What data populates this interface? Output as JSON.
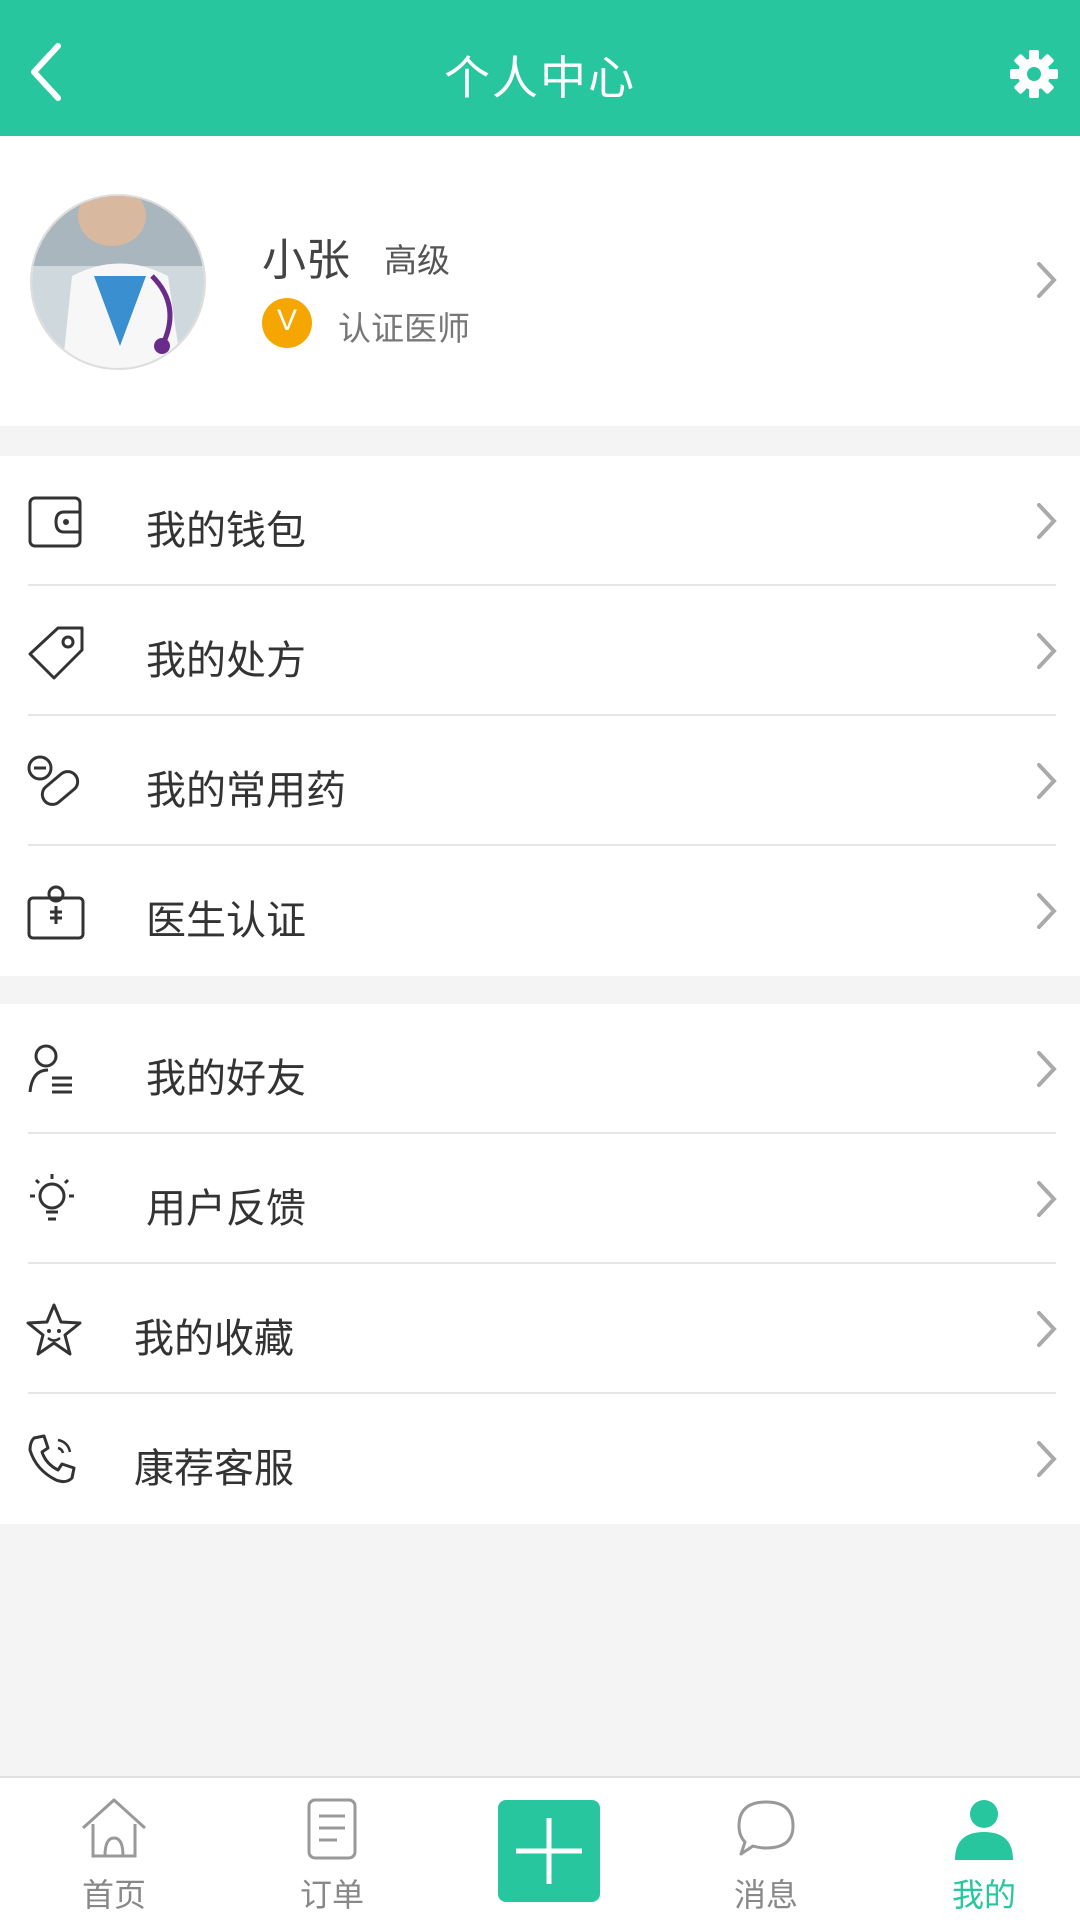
{
  "header": {
    "title": "个人中心"
  },
  "profile": {
    "name": "小张",
    "level": "高级",
    "badge_letter": "V",
    "certification": "认证医师"
  },
  "menu_group_1": [
    {
      "label": "我的钱包",
      "icon": "wallet-icon"
    },
    {
      "label": "我的处方",
      "icon": "tag-icon"
    },
    {
      "label": "我的常用药",
      "icon": "pills-icon"
    },
    {
      "label": "医生认证",
      "icon": "doctor-kit-icon"
    }
  ],
  "menu_group_2": [
    {
      "label": "我的好友",
      "icon": "friends-icon"
    },
    {
      "label": "用户反馈",
      "icon": "lightbulb-icon"
    },
    {
      "label": "我的收藏",
      "icon": "star-icon"
    },
    {
      "label": "康荐客服",
      "icon": "phone-icon"
    }
  ],
  "nav": {
    "home": "首页",
    "orders": "订单",
    "messages": "消息",
    "mine": "我的"
  },
  "colors": {
    "accent": "#27c69f",
    "badge": "#f5a600"
  }
}
